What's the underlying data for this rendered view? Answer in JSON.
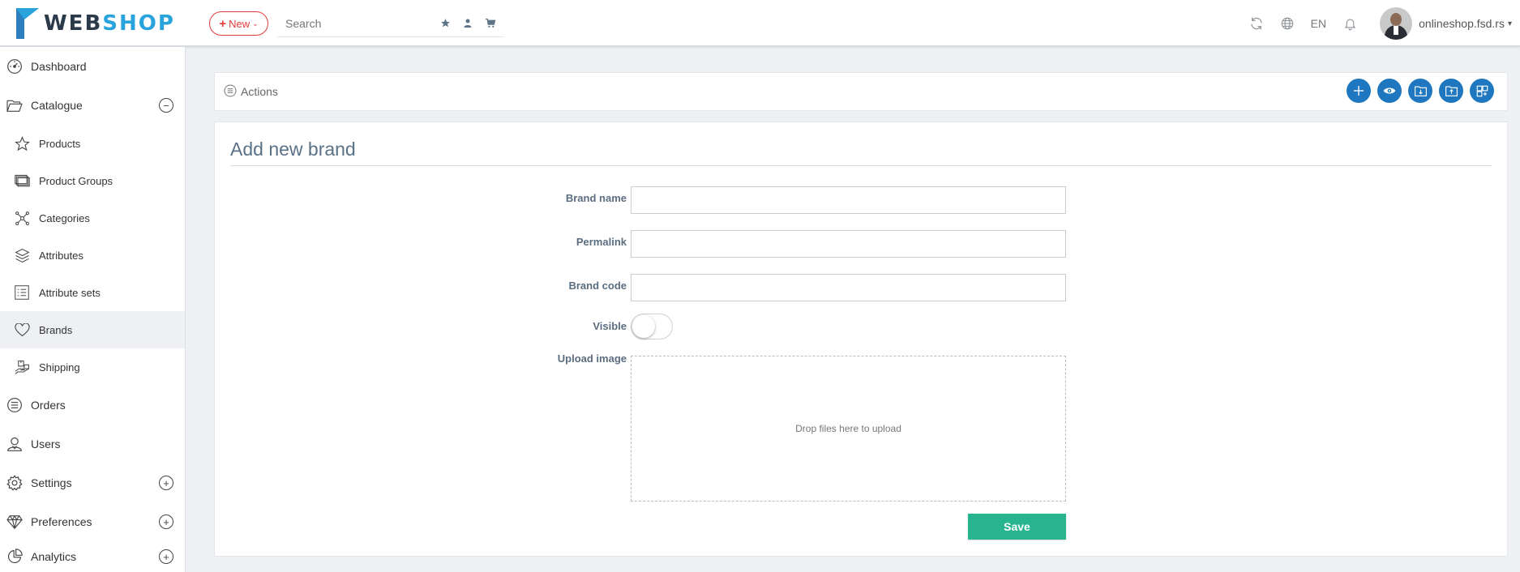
{
  "header": {
    "logo": {
      "part1": "WEB",
      "part2": "SHOP"
    },
    "new_button": {
      "icon": "+",
      "label": "New",
      "caret": "⌄"
    },
    "search": {
      "placeholder": "Search"
    },
    "language": "EN",
    "user": {
      "name": "onlineshop.fsd.rs",
      "caret": "▾"
    }
  },
  "sidebar": {
    "items": [
      {
        "label": "Dashboard",
        "icon": "dashboard-icon"
      },
      {
        "label": "Catalogue",
        "icon": "folder-icon",
        "toggle": "−"
      },
      {
        "label": "Products",
        "icon": "star-icon"
      },
      {
        "label": "Product Groups",
        "icon": "layers-folder-icon"
      },
      {
        "label": "Categories",
        "icon": "network-icon"
      },
      {
        "label": "Attributes",
        "icon": "stack-icon"
      },
      {
        "label": "Attribute sets",
        "icon": "list-icon"
      },
      {
        "label": "Brands",
        "icon": "heart-icon",
        "active": true
      },
      {
        "label": "Shipping",
        "icon": "shipping-icon"
      },
      {
        "label": "Orders",
        "icon": "orders-icon"
      },
      {
        "label": "Users",
        "icon": "users-icon"
      },
      {
        "label": "Settings",
        "icon": "gear-icon",
        "toggle": "+"
      },
      {
        "label": "Preferences",
        "icon": "diamond-icon",
        "toggle": "+"
      },
      {
        "label": "Analytics",
        "icon": "pie-chart-icon",
        "toggle": "+"
      }
    ]
  },
  "actions": {
    "label": "Actions"
  },
  "form": {
    "title": "Add new brand",
    "fields": {
      "brand_name": {
        "label": "Brand name",
        "value": ""
      },
      "permalink": {
        "label": "Permalink",
        "value": ""
      },
      "brand_code": {
        "label": "Brand code",
        "value": ""
      },
      "visible": {
        "label": "Visible",
        "value": false
      },
      "upload_image": {
        "label": "Upload image",
        "dropzone_text": "Drop files here to upload"
      }
    },
    "save_label": "Save"
  },
  "colors": {
    "accent_blue": "#1f77c0",
    "logo_blue": "#29a3dc",
    "new_red": "#e33b3b",
    "save_green": "#27b48e",
    "title_slate": "#5a7185"
  }
}
